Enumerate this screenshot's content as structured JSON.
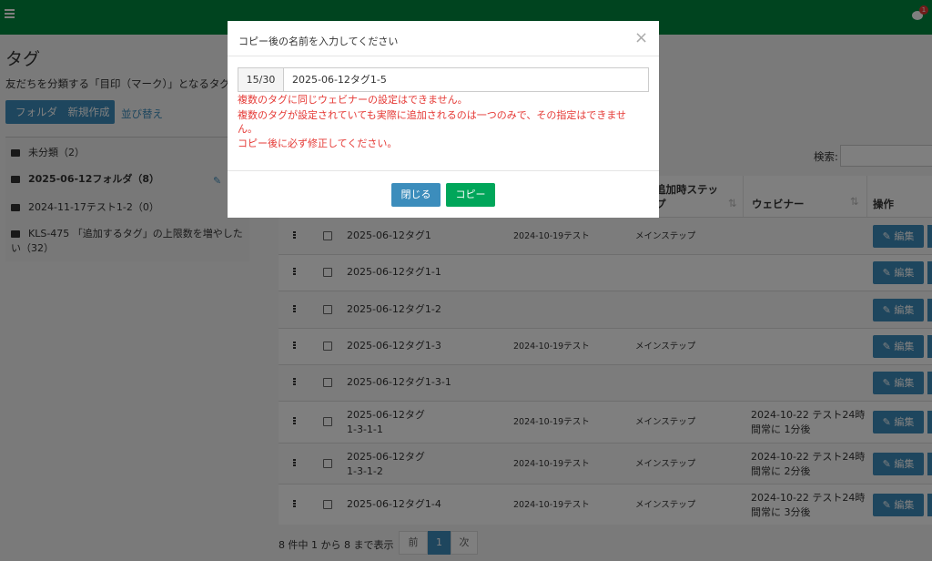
{
  "page": {
    "title": "タグ",
    "description": "友だちを分類する「目印（マーク）」となるタグ",
    "folder_button": "フォルダ　新規作成",
    "sort_link": "並び替え",
    "badge_count": "1"
  },
  "folders": [
    {
      "label": "未分類（2）",
      "bold": false
    },
    {
      "label": "2025-06-12フォルダ（8）",
      "bold": true
    },
    {
      "label": "2024-11-17テスト1-2（0）",
      "bold": false
    },
    {
      "label": "KLS-475 「追加するタグ」の上限数を増やした",
      "bold": false
    },
    {
      "label": "い（32）",
      "bold": false
    }
  ],
  "search": {
    "label": "検索:"
  },
  "table": {
    "headers": {
      "step": "追加時ステッ",
      "step2": "プ",
      "webinar": "ウェビナー",
      "ops": "操作"
    },
    "edit_label": "編集",
    "rows": [
      {
        "name": "2025-06-12タグ1",
        "name2": "",
        "scenario": "2024-10-19テスト",
        "step": "メインステップ",
        "webinar": "",
        "webinar2": ""
      },
      {
        "name": "2025-06-12タグ1-1",
        "name2": "",
        "scenario": "",
        "step": "",
        "webinar": "",
        "webinar2": ""
      },
      {
        "name": "2025-06-12タグ1-2",
        "name2": "",
        "scenario": "",
        "step": "",
        "webinar": "",
        "webinar2": ""
      },
      {
        "name": "2025-06-12タグ1-3",
        "name2": "",
        "scenario": "2024-10-19テスト",
        "step": "メインステップ",
        "webinar": "",
        "webinar2": ""
      },
      {
        "name": "2025-06-12タグ1-3-1",
        "name2": "",
        "scenario": "",
        "step": "",
        "webinar": "",
        "webinar2": ""
      },
      {
        "name": "2025-06-12タグ",
        "name2": "1-3-1-1",
        "scenario": "2024-10-19テスト",
        "step": "メインステップ",
        "webinar": "2024-10-22 テスト24時",
        "webinar2": "間常に 1分後"
      },
      {
        "name": "2025-06-12タグ",
        "name2": "1-3-1-2",
        "scenario": "2024-10-19テスト",
        "step": "メインステップ",
        "webinar": "2024-10-22 テスト24時",
        "webinar2": "間常に 2分後"
      },
      {
        "name": "2025-06-12タグ1-4",
        "name2": "",
        "scenario": "2024-10-19テスト",
        "step": "メインステップ",
        "webinar": "2024-10-22 テスト24時",
        "webinar2": "間常に 3分後"
      }
    ]
  },
  "pager": {
    "info": "8 件中 1 から 8 まで表示",
    "prev": "前",
    "current": "1",
    "next": "次"
  },
  "modal": {
    "title": "コピー後の名前を入力してください",
    "close_icon": "×",
    "counter": "15/30",
    "value": "2025-06-12タグ1-5",
    "errors": [
      "複数のタグに同じウェビナーの設定はできません。",
      "複数のタグが設定されていても実際に追加されるのは一つのみで、その指定はできませ",
      "ん。",
      "コピー後に必ず修正してください。"
    ],
    "close_button": "閉じる",
    "copy_button": "コピー"
  },
  "colors": {
    "topbar": "#00893f",
    "primary": "#3c8dbc",
    "success": "#00a65a",
    "error": "#e53935"
  }
}
